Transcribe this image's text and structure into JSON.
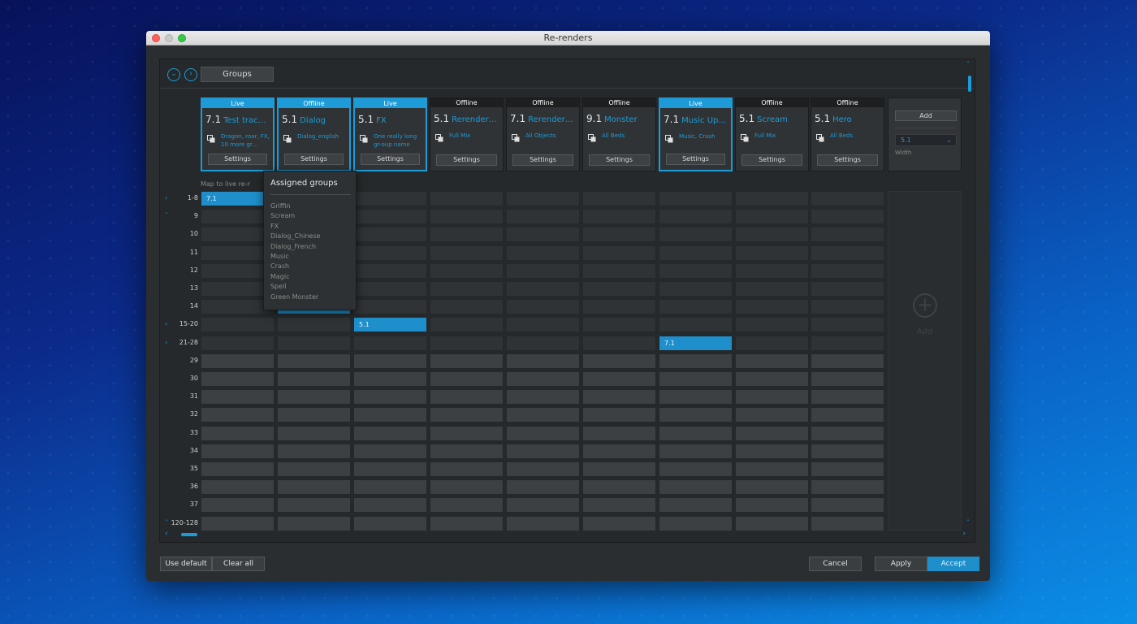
{
  "window": {
    "title": "Re-renders"
  },
  "topbar": {
    "collapse_icon": "chevron-down-circle",
    "expand_icon": "chevron-right-circle",
    "groups_label": "Groups"
  },
  "colors": {
    "accent": "#1e9bd7",
    "panel": "#26292b"
  },
  "renders": [
    {
      "status": "Live",
      "format": "7.1",
      "name": "Test track is …",
      "groups": "Dragon, roar, FX, 10 more gr…",
      "settings": "Settings",
      "live": true
    },
    {
      "status": "Offline",
      "format": "5.1",
      "name": "Dialog",
      "groups": "Dialog_english",
      "settings": "Settings",
      "live": true
    },
    {
      "status": "Live",
      "format": "5.1",
      "name": "FX",
      "groups": "One really long gr-oup name",
      "settings": "Settings",
      "live": true
    },
    {
      "status": "Offline",
      "format": "5.1",
      "name": "Rerender_04",
      "groups": "Full Mix",
      "settings": "Settings",
      "live": false
    },
    {
      "status": "Offline",
      "format": "7.1",
      "name": "Rerender_05",
      "groups": "All Objects",
      "settings": "Settings",
      "live": false
    },
    {
      "status": "Offline",
      "format": "9.1",
      "name": "Monster",
      "groups": "All Beds",
      "settings": "Settings",
      "live": false
    },
    {
      "status": "Live",
      "format": "7.1",
      "name": "Music Up B…",
      "groups": "Music, Crash",
      "settings": "Settings",
      "live": true
    },
    {
      "status": "Offline",
      "format": "5.1",
      "name": "Scream",
      "groups": "Full Mix",
      "settings": "Settings",
      "live": false
    },
    {
      "status": "Offline",
      "format": "5.1",
      "name": "Hero",
      "groups": "All Beds",
      "settings": "Settings",
      "live": false
    }
  ],
  "add_panel": {
    "add_label": "Add",
    "width_value": "5.1",
    "width_label": "Width"
  },
  "map_label": "Map to live re-r",
  "rows": [
    {
      "label": "1-8",
      "arrow": "›"
    },
    {
      "label": "9",
      "arrow": "ˇ"
    },
    {
      "label": "10",
      "arrow": ""
    },
    {
      "label": "11",
      "arrow": ""
    },
    {
      "label": "12",
      "arrow": ""
    },
    {
      "label": "13",
      "arrow": ""
    },
    {
      "label": "14",
      "arrow": ""
    },
    {
      "label": "15-20",
      "arrow": "›"
    },
    {
      "label": "21-28",
      "arrow": "›"
    },
    {
      "label": "29",
      "arrow": ""
    },
    {
      "label": "30",
      "arrow": ""
    },
    {
      "label": "31",
      "arrow": ""
    },
    {
      "label": "32",
      "arrow": ""
    },
    {
      "label": "33",
      "arrow": ""
    },
    {
      "label": "34",
      "arrow": ""
    },
    {
      "label": "35",
      "arrow": ""
    },
    {
      "label": "36",
      "arrow": ""
    },
    {
      "label": "37",
      "arrow": ""
    },
    {
      "label": "120-128",
      "arrow": "ˇ"
    }
  ],
  "assignments": [
    {
      "row": 0,
      "col": 0,
      "text": "7.1"
    },
    {
      "row": 1,
      "col": 1,
      "text": ""
    },
    {
      "row": 2,
      "col": 1,
      "text": ""
    },
    {
      "row": 3,
      "col": 1,
      "text": ""
    },
    {
      "row": 4,
      "col": 1,
      "text": ""
    },
    {
      "row": 5,
      "col": 1,
      "text": "5.1 - Rrs"
    },
    {
      "row": 6,
      "col": 1,
      "text": "5.1 - Lrs"
    },
    {
      "row": 7,
      "col": 2,
      "text": "5.1"
    },
    {
      "row": 8,
      "col": 6,
      "text": "7.1"
    }
  ],
  "add_zone": {
    "label": "Add"
  },
  "popup": {
    "title": "Assigned groups",
    "items": [
      "Griffin",
      "Scream",
      "FX",
      "Dialog_Chinese",
      "Dialog_French",
      "Music",
      "Crash",
      "Magic",
      "Spell",
      "Green Monster"
    ]
  },
  "footer": {
    "use_default": "Use default",
    "clear_all": "Clear all",
    "cancel": "Cancel",
    "apply": "Apply",
    "accept": "Accept"
  }
}
